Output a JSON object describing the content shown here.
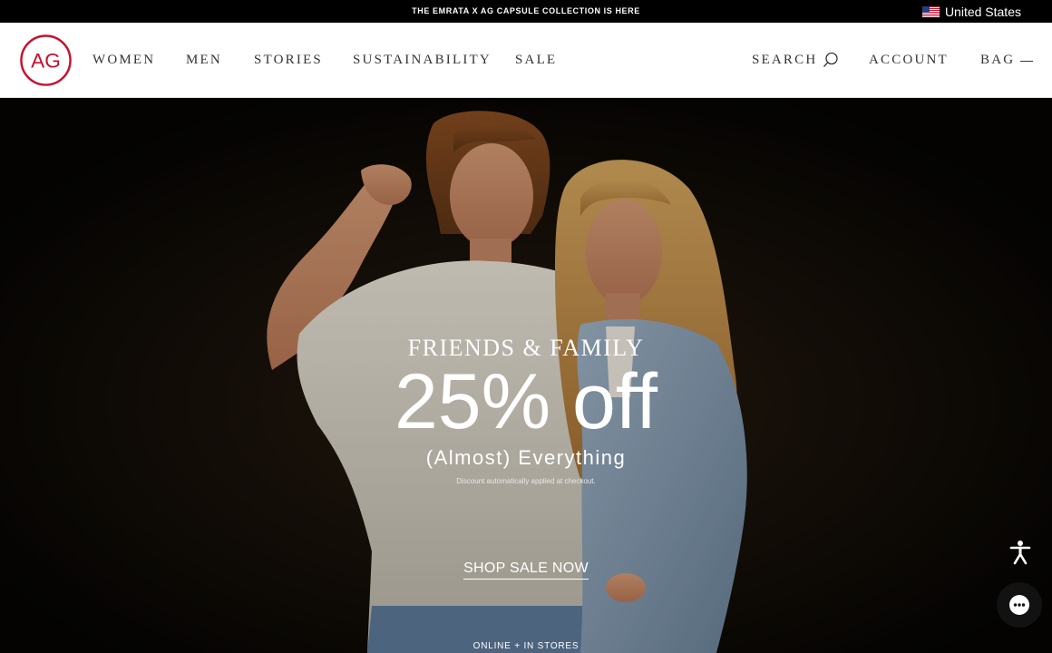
{
  "announcement": {
    "text": "THE EMRATA X AG CAPSULE COLLECTION IS HERE"
  },
  "locale": {
    "country": "United States",
    "flag_icon": "us-flag-icon"
  },
  "brand": {
    "logo_text": "AG",
    "logo_color": "#c8102e"
  },
  "nav": {
    "women": "WOMEN",
    "men": "MEN",
    "stories": "STORIES",
    "sustainability": "SUSTAINABILITY",
    "sale": "SALE"
  },
  "utility": {
    "search": "SEARCH",
    "account": "ACCOUNT",
    "bag": "BAG"
  },
  "hero": {
    "eyebrow": "FRIENDS & FAMILY",
    "headline": "25% off",
    "subheadline": "(Almost) Everything",
    "fine_print": "Discount automatically applied at checkout.",
    "cta": "SHOP SALE NOW",
    "availability": "ONLINE + IN STORES",
    "image_icon": "hero-couple-photo"
  },
  "floating": {
    "accessibility_icon": "accessibility-icon",
    "chat_icon": "chat-icon"
  }
}
